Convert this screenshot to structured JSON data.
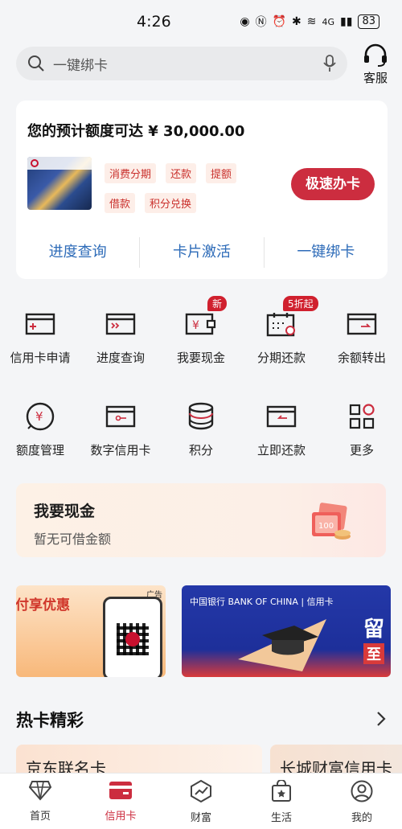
{
  "status": {
    "time": "4:26",
    "network": "4G",
    "battery": "83"
  },
  "search": {
    "placeholder": "一键绑卡",
    "service_label": "客服"
  },
  "quota": {
    "title": "您的预计额度可达 ¥ 30,000.00",
    "tags": [
      "消费分期",
      "还款",
      "提额",
      "借款",
      "积分兑换"
    ],
    "apply_label": "极速办卡",
    "links": [
      "进度查询",
      "卡片激活",
      "一键绑卡"
    ]
  },
  "grid": {
    "row1": [
      {
        "label": "信用卡申请",
        "icon": "card-apply-icon"
      },
      {
        "label": "进度查询",
        "icon": "progress-icon"
      },
      {
        "label": "我要现金",
        "icon": "cash-wallet-icon",
        "badge": "新"
      },
      {
        "label": "分期还款",
        "icon": "calendar-icon",
        "badge": "5折起"
      },
      {
        "label": "余额转出",
        "icon": "transfer-icon"
      }
    ],
    "row2": [
      {
        "label": "额度管理",
        "icon": "quota-icon"
      },
      {
        "label": "数字信用卡",
        "icon": "digital-card-icon"
      },
      {
        "label": "积分",
        "icon": "points-icon"
      },
      {
        "label": "立即还款",
        "icon": "repay-icon"
      },
      {
        "label": "更多",
        "icon": "more-grid-icon"
      }
    ]
  },
  "cash": {
    "title": "我要现金",
    "subtitle": "暂无可借金额",
    "art_label": "100"
  },
  "ads": {
    "ad1_text": "支付享优惠",
    "ad1_tag": "广告",
    "ad2_bank": "中国银行 BANK OF CHINA | 信用卡",
    "ad2_big1": "留",
    "ad2_big2": "至"
  },
  "hot": {
    "title": "热卡精彩",
    "cards": [
      "京东联名卡",
      "长城财富信用卡"
    ]
  },
  "tabs": [
    {
      "label": "首页",
      "icon": "home-diamond-icon",
      "active": false
    },
    {
      "label": "信用卡",
      "icon": "credit-card-icon",
      "active": true
    },
    {
      "label": "财富",
      "icon": "wealth-chart-icon",
      "active": false
    },
    {
      "label": "生活",
      "icon": "life-bag-icon",
      "active": false
    },
    {
      "label": "我的",
      "icon": "profile-icon",
      "active": false
    }
  ],
  "colors": {
    "accent": "#cc2d3f",
    "link": "#2d6bb8",
    "tag_bg": "#fdeee8"
  }
}
